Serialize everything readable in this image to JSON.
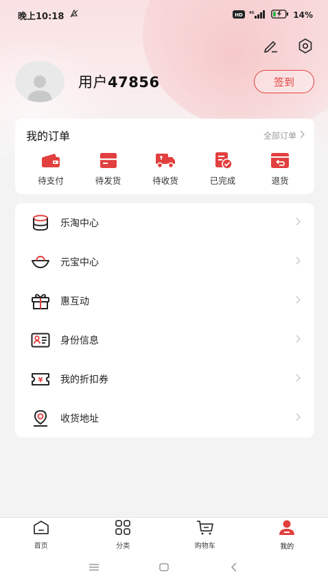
{
  "status_bar": {
    "time": "晚上10:18",
    "network": "4G",
    "battery": "14%"
  },
  "header": {
    "edit_icon": "edit-icon",
    "settings_icon": "settings-icon"
  },
  "profile": {
    "name_prefix": "用户",
    "name_number": "47856",
    "signin_label": "签到"
  },
  "orders": {
    "title": "我的订单",
    "all_label": "全部订单",
    "items": [
      {
        "label": "待支付",
        "icon": "wallet-icon"
      },
      {
        "label": "待发货",
        "icon": "package-icon"
      },
      {
        "label": "待收货",
        "icon": "truck-icon"
      },
      {
        "label": "已完成",
        "icon": "done-icon"
      },
      {
        "label": "退货",
        "icon": "return-icon"
      }
    ]
  },
  "menu": {
    "items": [
      {
        "label": "乐淘中心",
        "icon": "coins-icon"
      },
      {
        "label": "元宝中心",
        "icon": "ingot-icon"
      },
      {
        "label": "惠互动",
        "icon": "gift-icon"
      },
      {
        "label": "身份信息",
        "icon": "id-card-icon"
      },
      {
        "label": "我的折扣券",
        "icon": "coupon-icon"
      },
      {
        "label": "收货地址",
        "icon": "location-icon"
      }
    ]
  },
  "tabbar": {
    "tabs": [
      {
        "label": "首页",
        "icon": "home-icon",
        "active": false
      },
      {
        "label": "分类",
        "icon": "category-icon",
        "active": false
      },
      {
        "label": "购物车",
        "icon": "cart-icon",
        "active": false
      },
      {
        "label": "我的",
        "icon": "user-icon",
        "active": true
      }
    ]
  },
  "colors": {
    "accent": "#e2403f",
    "background": "#f3f3f3"
  }
}
